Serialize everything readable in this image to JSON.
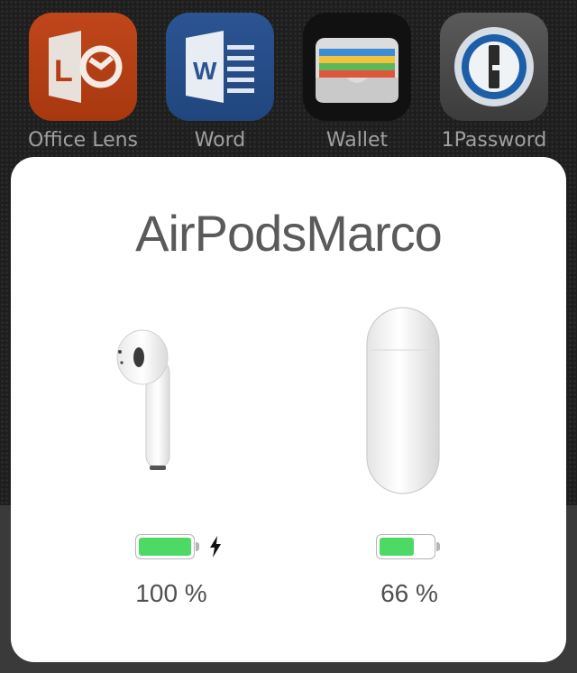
{
  "apps": [
    {
      "label": "Office Lens",
      "icon": "office-lens-icon"
    },
    {
      "label": "Word",
      "icon": "word-icon"
    },
    {
      "label": "Wallet",
      "icon": "wallet-icon"
    },
    {
      "label": "1Password",
      "icon": "1password-icon"
    }
  ],
  "popup": {
    "device_name": "AirPodsMarco",
    "airpods": {
      "image": "airpod-icon",
      "battery_percent": 100,
      "battery_label": "100 %",
      "charging": true
    },
    "case": {
      "image": "airpods-case-icon",
      "battery_percent": 66,
      "battery_label": "66 %",
      "charging": false
    }
  },
  "colors": {
    "battery_fill": "#4cd964",
    "sheet_bg": "#ffffff",
    "text": "#5a5a5a"
  }
}
